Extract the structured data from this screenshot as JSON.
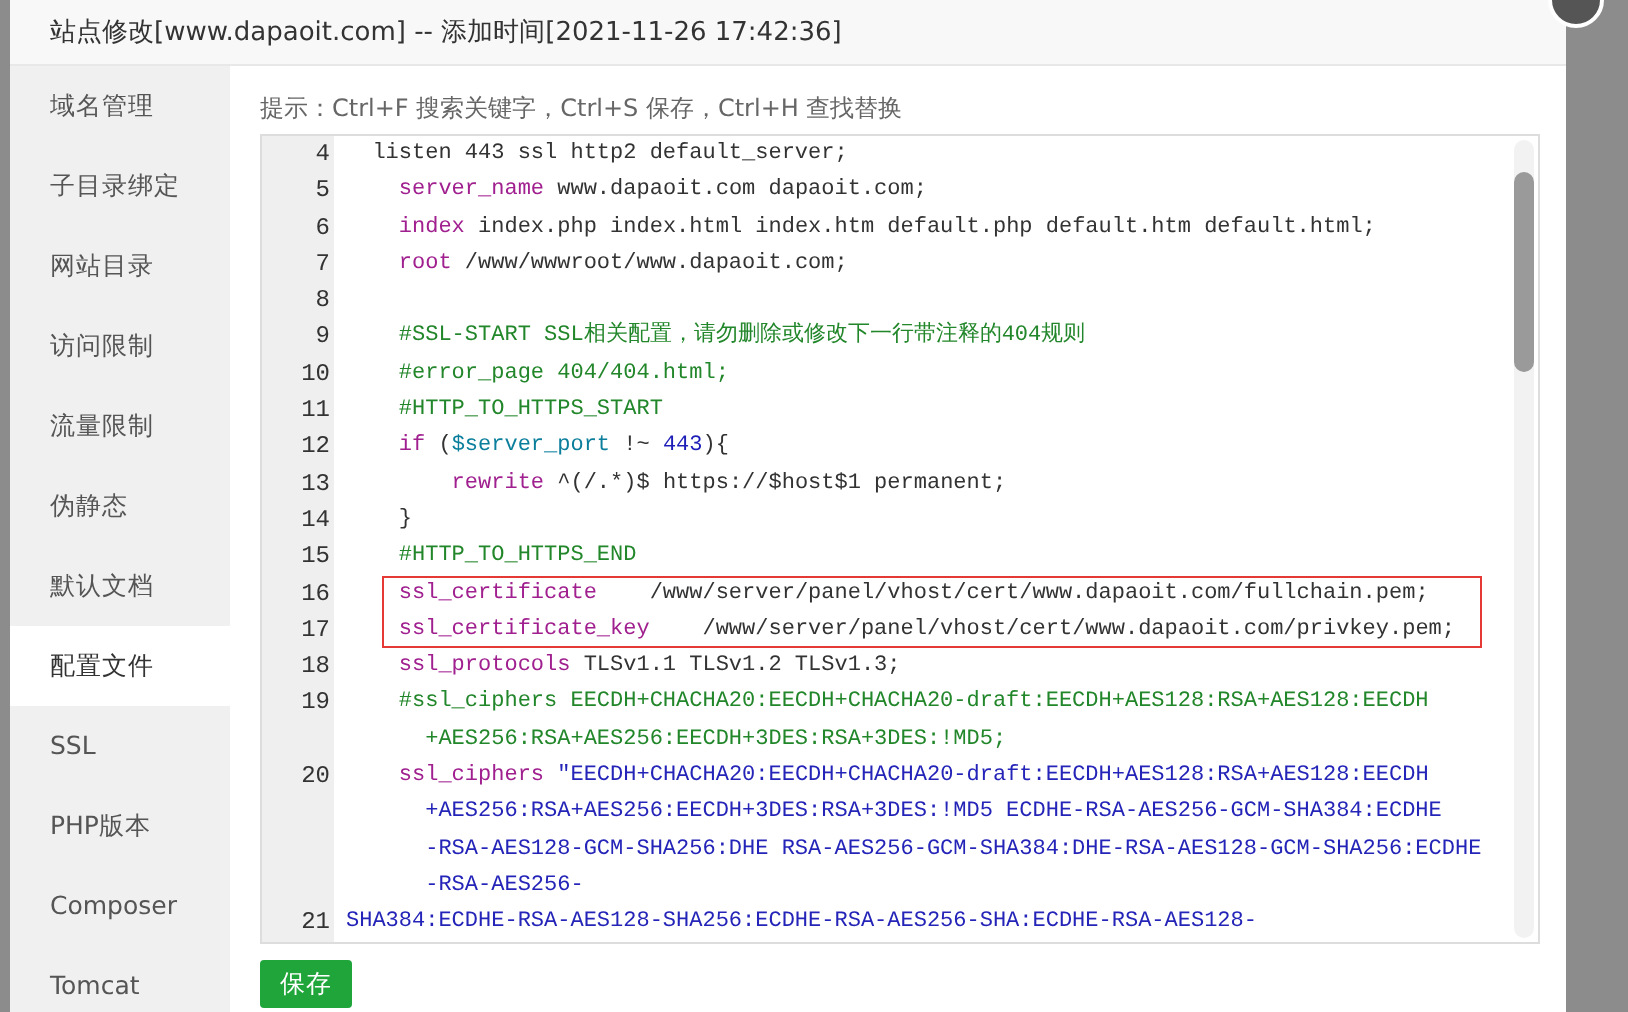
{
  "dialog": {
    "title": "站点修改[www.dapaoit.com] -- 添加时间[2021-11-26 17:42:36]"
  },
  "sidebar": {
    "items": [
      {
        "label": "域名管理",
        "selected": false
      },
      {
        "label": "子目录绑定",
        "selected": false
      },
      {
        "label": "网站目录",
        "selected": false
      },
      {
        "label": "访问限制",
        "selected": false
      },
      {
        "label": "流量限制",
        "selected": false
      },
      {
        "label": "伪静态",
        "selected": false
      },
      {
        "label": "默认文档",
        "selected": false
      },
      {
        "label": "配置文件",
        "selected": true
      },
      {
        "label": "SSL",
        "selected": false
      },
      {
        "label": "PHP版本",
        "selected": false
      },
      {
        "label": "Composer",
        "selected": false
      },
      {
        "label": "Tomcat",
        "selected": false
      }
    ]
  },
  "hint": "提示：Ctrl+F 搜索关键字，Ctrl+S 保存，Ctrl+H 查找替换",
  "editor": {
    "lines": [
      {
        "number": "4",
        "boxed": false,
        "rows": [
          [
            {
              "kind": "plain",
              "text": "  listen 443 ssl http2 default_server;"
            }
          ]
        ]
      },
      {
        "number": "5",
        "boxed": false,
        "rows": [
          [
            {
              "kind": "keyword",
              "text": "    server_name"
            },
            {
              "kind": "plain",
              "text": " www.dapaoit.com dapaoit.com;"
            }
          ]
        ]
      },
      {
        "number": "6",
        "boxed": false,
        "rows": [
          [
            {
              "kind": "keyword",
              "text": "    index"
            },
            {
              "kind": "plain",
              "text": " index.php index.html index.htm default.php default.htm default.html;"
            }
          ]
        ]
      },
      {
        "number": "7",
        "boxed": false,
        "rows": [
          [
            {
              "kind": "keyword",
              "text": "    root"
            },
            {
              "kind": "plain",
              "text": " /www/wwwroot/www.dapaoit.com;"
            }
          ]
        ]
      },
      {
        "number": "8",
        "boxed": false
      },
      {
        "number": "9",
        "boxed": false,
        "rows": [
          [
            {
              "kind": "comment",
              "text": "    #SSL-START SSL相关配置，请勿删除或修改下一行带注释的404规则"
            }
          ]
        ]
      },
      {
        "number": "10",
        "boxed": false,
        "rows": [
          [
            {
              "kind": "comment",
              "text": "    #error_page 404/404.html;"
            }
          ]
        ]
      },
      {
        "number": "11",
        "boxed": false,
        "rows": [
          [
            {
              "kind": "comment",
              "text": "    #HTTP_TO_HTTPS_START"
            }
          ]
        ]
      },
      {
        "number": "12",
        "boxed": false,
        "rows": [
          [
            {
              "kind": "keyword",
              "text": "    if"
            },
            {
              "kind": "plain",
              "text": " ("
            },
            {
              "kind": "variable",
              "text": "$server_port"
            },
            {
              "kind": "plain",
              "text": " !~ "
            },
            {
              "kind": "number",
              "text": "443"
            },
            {
              "kind": "plain",
              "text": "){"
            }
          ]
        ]
      },
      {
        "number": "13",
        "boxed": false,
        "rows": [
          [
            {
              "kind": "keyword",
              "text": "        rewrite"
            },
            {
              "kind": "plain",
              "text": " ^(/.*)$ https://$host$1 permanent;"
            }
          ]
        ]
      },
      {
        "number": "14",
        "boxed": false,
        "rows": [
          [
            {
              "kind": "plain",
              "text": "    }"
            }
          ]
        ]
      },
      {
        "number": "15",
        "boxed": false,
        "rows": [
          [
            {
              "kind": "comment",
              "text": "    #HTTP_TO_HTTPS_END"
            }
          ]
        ]
      },
      {
        "number": "16",
        "boxed": true,
        "rows": [
          [
            {
              "kind": "keyword",
              "text": "    ssl_certificate"
            },
            {
              "kind": "plain",
              "text": "    /www/server/panel/vhost/cert/www.dapaoit.com/fullchain.pem;"
            }
          ]
        ]
      },
      {
        "number": "17",
        "boxed": true,
        "rows": [
          [
            {
              "kind": "keyword",
              "text": "    ssl_certificate_key"
            },
            {
              "kind": "plain",
              "text": "    /www/server/panel/vhost/cert/www.dapaoit.com/privkey.pem;"
            }
          ]
        ]
      },
      {
        "number": "18",
        "boxed": false,
        "rows": [
          [
            {
              "kind": "keyword",
              "text": "    ssl_protocols"
            },
            {
              "kind": "plain",
              "text": " TLSv1.1 TLSv1.2 TLSv1.3;"
            }
          ]
        ]
      },
      {
        "number": "19",
        "boxed": false,
        "rows": [
          [
            {
              "kind": "comment",
              "text": "    #ssl_ciphers EECDH+CHACHA20:EECDH+CHACHA20-draft:EECDH+AES128:RSA+AES128:EECDH"
            }
          ],
          [
            {
              "kind": "comment",
              "text": "      +AES256:RSA+AES256:EECDH+3DES:RSA+3DES:!MD5;"
            }
          ]
        ]
      },
      {
        "number": "20",
        "boxed": false,
        "rows": [
          [
            {
              "kind": "keyword",
              "text": "    ssl_ciphers"
            },
            {
              "kind": "string",
              "text": " \"EECDH+CHACHA20:EECDH+CHACHA20-draft:EECDH+AES128:RSA+AES128:EECDH"
            }
          ],
          [
            {
              "kind": "string",
              "text": "      +AES256:RSA+AES256:EECDH+3DES:RSA+3DES:!MD5 ECDHE-RSA-AES256-GCM-SHA384:ECDHE"
            }
          ],
          [
            {
              "kind": "string",
              "text": "      -RSA-AES128-GCM-SHA256:DHE RSA-AES256-GCM-SHA384:DHE-RSA-AES128-GCM-SHA256:ECDHE"
            }
          ],
          [
            {
              "kind": "string",
              "text": "      -RSA-AES256-"
            }
          ]
        ]
      },
      {
        "number": "21",
        "boxed": false,
        "rows": [
          [
            {
              "kind": "string",
              "text": "SHA384:ECDHE-RSA-AES128-SHA256:ECDHE-RSA-AES256-SHA:ECDHE-RSA-AES128-"
            }
          ]
        ]
      }
    ]
  },
  "save_button": "保存"
}
